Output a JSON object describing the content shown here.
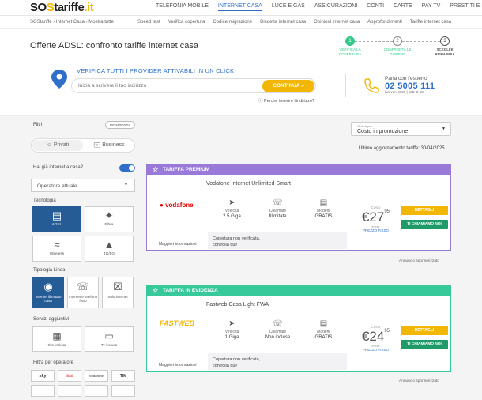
{
  "brand": {
    "logo_text": "SOStariffe.it"
  },
  "topnav": [
    "TELEFONIA MOBILE",
    "INTERNET CASA",
    "LUCE E GAS",
    "ASSICURAZIONI",
    "CONTI",
    "CARTE",
    "PAY TV",
    "PRESTITI E MUTUI"
  ],
  "breadcrumb": "SOStariffe › Internet Casa › Mostra tutte",
  "subnav": [
    "Speed test",
    "Verifica copertura",
    "Codice migrazione",
    "Disdetta internet casa",
    "Opinioni internet casa",
    "Approfondimenti",
    "Tariffe internet casa"
  ],
  "page_title": "Offerte ADSL: confronto tariffe internet casa",
  "steps": [
    {
      "num": "1",
      "label": "VERIFICA LA COPERTURA"
    },
    {
      "num": "2",
      "label": "CONFRONTA LE TARIFFE"
    },
    {
      "num": "3",
      "label": "SCEGLI E RISPARMIA"
    }
  ],
  "verify": {
    "title": "VERIFICA TUTTI I PROVIDER ATTIVABILI IN UN CLICK",
    "placeholder": "Inizia a scrivere il tuo indirizzo",
    "button": "CONTINUA »",
    "why": "ⓘ Perché inserire l'indirizzo?"
  },
  "expert": {
    "label": "Parla con l'esperto",
    "phone": "02 5005 111",
    "hours": "lun-ven: 8-21 | sab: 9-18"
  },
  "filters": {
    "title": "Filtri",
    "reset": "REIMPOSTA",
    "private": "Privati",
    "business": "Business",
    "has_internet": "Hai già internet a casa?",
    "current_operator": "Operatore attuale",
    "tech_title": "Tecnologia",
    "tech": [
      "ADSL",
      "Fibra",
      "Wireless",
      "4G/5G"
    ],
    "line_title": "Tipologia Linea",
    "line": [
      "Internet illimitato casa",
      "Internet e telefono fisso",
      "Solo internet"
    ],
    "extra_title": "Servizi aggiuntivi",
    "extra": [
      "Sim inclusa",
      "Tv inclusa"
    ],
    "operators_title": "Filtra per operatore",
    "operators": [
      "sky",
      "iliad",
      "vodafone",
      "TIM",
      "",
      "",
      "",
      ""
    ]
  },
  "sort": {
    "label": "Ordina per",
    "value": "Costo in promozione"
  },
  "updated": "Ultimo aggiornamento tariffe: 30/04/2025",
  "offers": [
    {
      "badge": "TARIFFA PREMIUM",
      "title": "Vodafone Internet Unlimited Smart",
      "brand": "vodafone",
      "features": [
        {
          "label": "Velocità",
          "value": "2.5 Gigа"
        },
        {
          "label": "Chiamate",
          "value": "Illimitate"
        },
        {
          "label": "Modem",
          "value": "GRATIS"
        }
      ],
      "more": "Maggiori informazioni",
      "coverage": "Copertura non verificata,",
      "coverage_link": "controlla qui!",
      "cost_label": "Costo",
      "price_int": "€27",
      "price_dec": "95",
      "per": "/mese",
      "fixed": "PREZZO FISSO",
      "details": "DETTAGLI",
      "call": "TI CHIAMIAMO NOI",
      "sponsor": "Annuncio sponsorizzato"
    },
    {
      "badge": "TARIFFA IN EVIDENZA",
      "title": "Fastweb Casa Light FWA",
      "brand": "FASTWEB",
      "features": [
        {
          "label": "Velocità",
          "value": "1 Giga"
        },
        {
          "label": "Chiamate",
          "value": "Non incluse"
        },
        {
          "label": "Modem",
          "value": "GRATIS"
        }
      ],
      "more": "Maggiori informazioni",
      "coverage": "Copertura non verificata,",
      "coverage_link": "controlla qui!",
      "cost_label": "Costo",
      "price_int": "€24",
      "price_dec": "95",
      "per": "/mese",
      "fixed": "PREZZO FISSO",
      "details": "DETTAGLI",
      "call": "TI CHIAMIAMO NOI",
      "sponsor": "Annuncio sponsorizzato"
    }
  ],
  "colors": {
    "accent": "#2d6fc9",
    "cta": "#f2b705",
    "premium": "#9a7ad9",
    "evidenza": "#37c99a",
    "call": "#1f9b6a",
    "selected_tile": "#255c96"
  }
}
